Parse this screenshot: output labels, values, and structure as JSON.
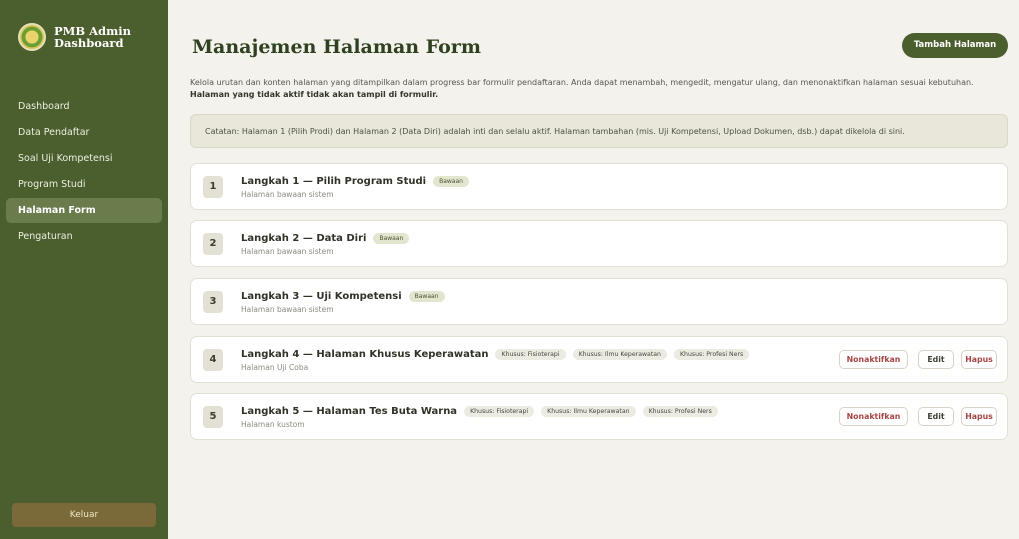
{
  "sidebar": {
    "brand_line1": "PMB Admin",
    "brand_line2": "Dashboard",
    "items": [
      {
        "label": "Dashboard"
      },
      {
        "label": "Data Pendaftar"
      },
      {
        "label": "Soal Uji Kompetensi"
      },
      {
        "label": "Program Studi"
      },
      {
        "label": "Halaman Form",
        "active": true
      },
      {
        "label": "Pengaturan"
      }
    ],
    "logout_label": "Keluar"
  },
  "header": {
    "title": "Manajemen Halaman Form",
    "add_button": "Tambah Halaman"
  },
  "description": {
    "text": "Kelola urutan dan konten halaman yang ditampilkan dalam progress bar formulir pendaftaran. Anda dapat menambah, mengedit, mengatur ulang, dan menonaktifkan halaman sesuai kebutuhan.",
    "bold": "Halaman yang tidak aktif tidak akan tampil di formulir."
  },
  "note": "Catatan: Halaman 1 (Pilih Prodi) dan Halaman 2 (Data Diri) adalah inti dan selalu aktif. Halaman tambahan (mis. Uji Kompetensi, Upload Dokumen, dsb.) dapat dikelola di sini.",
  "steps": [
    {
      "num": "1",
      "title": "Langkah 1 — Pilih Program Studi",
      "badge": "Bawaan",
      "subtitle": "Halaman bawaan sistem"
    },
    {
      "num": "2",
      "title": "Langkah 2 — Data Diri",
      "badge": "Bawaan",
      "subtitle": "Halaman bawaan sistem"
    },
    {
      "num": "3",
      "title": "Langkah 3 — Uji Kompetensi",
      "badge": "Bawaan",
      "subtitle": "Halaman bawaan sistem"
    },
    {
      "num": "4",
      "title": "Langkah 4 — Halaman Khusus Keperawatan",
      "tags": [
        "Khusus: Fisioterapi",
        "Khusus: Ilmu Keperawatan",
        "Khusus: Profesi Ners"
      ],
      "subtitle": "Halaman Uji Coba"
    },
    {
      "num": "5",
      "title": "Langkah 5 — Halaman Tes Buta Warna",
      "tags": [
        "Khusus: Fisioterapi",
        "Khusus: Ilmu Keperawatan",
        "Khusus: Profesi Ners"
      ],
      "subtitle": "Halaman kustom"
    }
  ],
  "actions": {
    "deactivate": "Nonaktifkan",
    "edit": "Edit",
    "delete": "Hapus"
  },
  "colors": {
    "sidebar": "#4b5e2d",
    "accent": "#4b5e2d",
    "danger": "#a64545"
  }
}
